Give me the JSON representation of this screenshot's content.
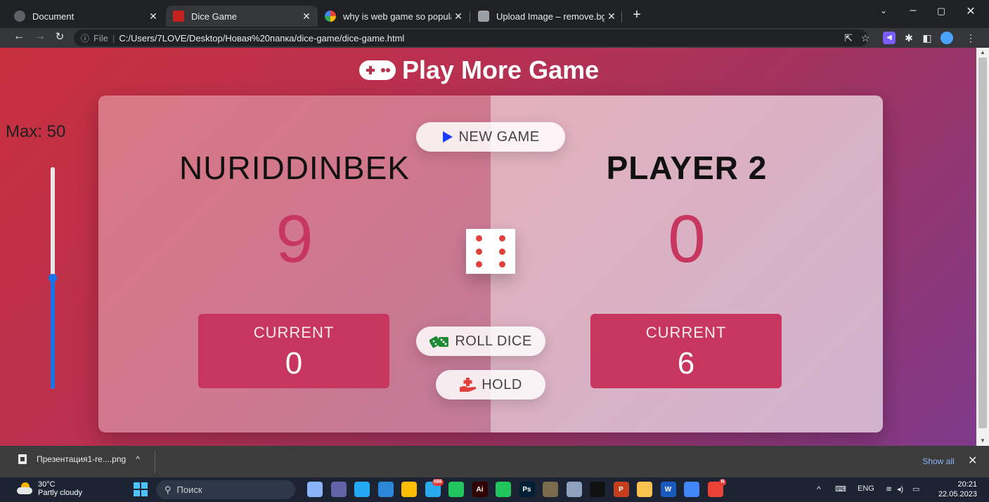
{
  "browser": {
    "tabs": [
      {
        "label": "Document",
        "icon": "globe-icon",
        "color": "#8ab4f8",
        "active": false
      },
      {
        "label": "Dice Game",
        "icon": "page-favicon-icon",
        "color": "#c5221f",
        "active": true
      },
      {
        "label": "why is web game so popular now",
        "icon": "google-icon",
        "color": "#4285f4",
        "active": false
      },
      {
        "label": "Upload Image – remove.bg",
        "icon": "removebg-icon",
        "color": "#9aa0a6",
        "active": false
      }
    ],
    "address": {
      "scheme_label": "File",
      "path": "C:/Users/7LOVE/Desktop/Новая%20папка/dice-game/dice-game.html"
    }
  },
  "page": {
    "title": "Play More Game",
    "max_label": "Max: 50",
    "max_slider_fraction": 0.5,
    "new_game_label": "NEW GAME",
    "roll_dice_label": "ROLL DICE",
    "hold_label": "HOLD",
    "dice_value": 6,
    "players": [
      {
        "name": "NURIDDINBEK",
        "score": "9",
        "current_label": "CURRENT",
        "current": "0"
      },
      {
        "name": "PLAYER 2",
        "score": "0",
        "current_label": "CURRENT",
        "current": "6"
      }
    ]
  },
  "download_bar": {
    "file_name": "Презентация1-re....png",
    "show_all_label": "Show all"
  },
  "taskbar": {
    "weather_temp": "30°C",
    "weather_desc": "Partly cloudy",
    "search_placeholder": "Поиск",
    "language": "ENG",
    "time": "20:21",
    "date": "22.05.2023",
    "apps": [
      {
        "name": "file-manager-icon",
        "label": "",
        "color": "#8ab4f8"
      },
      {
        "name": "chat-app-icon",
        "label": "",
        "color": "#6264a7"
      },
      {
        "name": "vscode-icon",
        "label": "",
        "color": "#23a9f2"
      },
      {
        "name": "monitor-icon",
        "label": "",
        "color": "#2b88d8"
      },
      {
        "name": "chrome-icon",
        "label": "",
        "color": "#fbbc04"
      },
      {
        "name": "telegram-icon",
        "label": "",
        "color": "#2aabee",
        "badge": "596"
      },
      {
        "name": "green-app-icon",
        "label": "",
        "color": "#22c55e"
      },
      {
        "name": "illustrator-icon",
        "label": "Ai",
        "color": "#330000"
      },
      {
        "name": "green-arrow-app-icon",
        "label": "",
        "color": "#21c45d"
      },
      {
        "name": "photoshop-icon",
        "label": "Ps",
        "color": "#001e36"
      },
      {
        "name": "minecraft-icon",
        "label": "",
        "color": "#7a6b4d"
      },
      {
        "name": "installer-icon",
        "label": "",
        "color": "#8fa3bf"
      },
      {
        "name": "tiktok-icon",
        "label": "",
        "color": "#111111"
      },
      {
        "name": "powerpoint-icon",
        "label": "P",
        "color": "#c43e1c"
      },
      {
        "name": "folder-icon",
        "label": "",
        "color": "#f8c44f"
      },
      {
        "name": "word-icon",
        "label": "W",
        "color": "#185abd"
      },
      {
        "name": "chrome-alt-icon",
        "label": "",
        "color": "#4285f4"
      },
      {
        "name": "chrome-profile-icon",
        "label": "",
        "color": "#ea4335",
        "badge": "N"
      }
    ]
  }
}
